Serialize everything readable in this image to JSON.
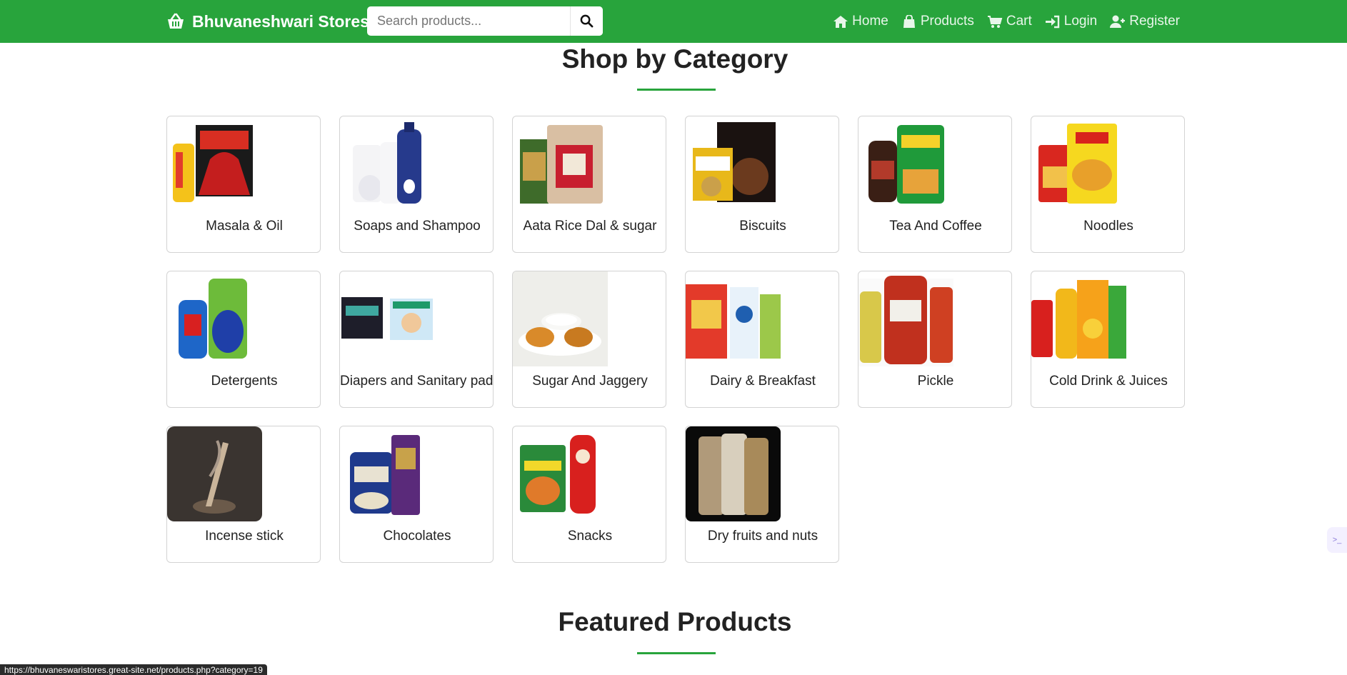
{
  "navbar": {
    "brand": "Bhuvaneshwari Stores",
    "search_placeholder": "Search products...",
    "links": [
      {
        "label": "Home",
        "icon": "home-icon"
      },
      {
        "label": "Products",
        "icon": "shopping-bag-icon"
      },
      {
        "label": "Cart",
        "icon": "cart-icon"
      },
      {
        "label": "Login",
        "icon": "login-icon"
      },
      {
        "label": "Register",
        "icon": "user-plus-icon"
      }
    ]
  },
  "sections": {
    "categories_title": "Shop by Category",
    "featured_title": "Featured Products"
  },
  "categories": [
    {
      "label": "Masala & Oil"
    },
    {
      "label": "Soaps and Shampoo"
    },
    {
      "label": "Aata Rice Dal & sugar"
    },
    {
      "label": "Biscuits"
    },
    {
      "label": "Tea And Coffee"
    },
    {
      "label": "Noodles"
    },
    {
      "label": "Detergents"
    },
    {
      "label": "Diapers and Sanitary pads"
    },
    {
      "label": "Sugar And Jaggery"
    },
    {
      "label": "Dairy & Breakfast"
    },
    {
      "label": "Pickle"
    },
    {
      "label": "Cold Drink & Juices"
    },
    {
      "label": "Incense stick"
    },
    {
      "label": "Chocolates"
    },
    {
      "label": "Snacks"
    },
    {
      "label": "Dry fruits and nuts"
    }
  ],
  "status_url": "https://bhuvaneswaristores.great-site.net/products.php?category=19",
  "colors": {
    "primary": "#28a43c",
    "card_border": "#d3d3d3"
  }
}
